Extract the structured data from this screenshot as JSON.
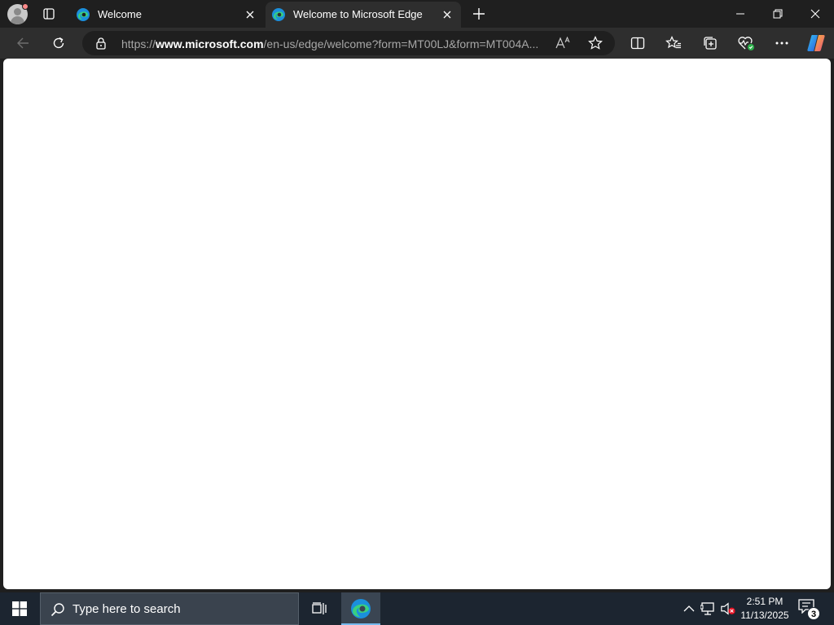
{
  "browser": {
    "tabs": [
      {
        "title": "Welcome",
        "active": false
      },
      {
        "title": "Welcome to Microsoft Edge",
        "active": true
      }
    ],
    "address": {
      "prefix": "https://",
      "host": "www.microsoft.com",
      "path": "/en-us/edge/welcome?form=MT00LJ&form=MT004A..."
    },
    "read_aloud_label": "Aᴬ"
  },
  "taskbar": {
    "search_placeholder": "Type here to search",
    "clock_time": "2:51 PM",
    "clock_date": "11/13/2025",
    "notification_count": "3"
  },
  "colors": {
    "tab_strip": "#1f1f1f",
    "toolbar": "#2e2e2e",
    "taskbar": "#1c2530",
    "content": "#ffffff"
  }
}
